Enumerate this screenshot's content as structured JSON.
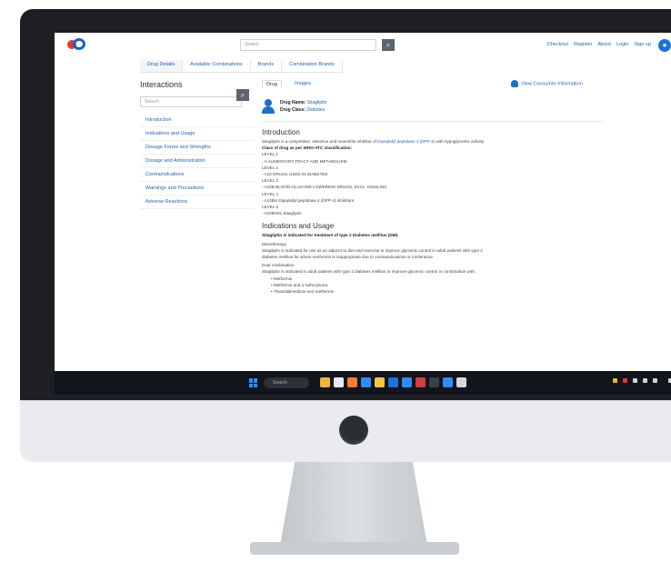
{
  "topbar": {
    "logo_caption": "",
    "search_placeholder": "Search",
    "links": [
      "Checkout",
      "Register",
      "About",
      "Login",
      "Sign up"
    ]
  },
  "tabs": [
    "Drug Details",
    "Available Combinations",
    "Brands",
    "Combination Brands"
  ],
  "sidebar": {
    "title": "Interactions",
    "search_placeholder": "Search",
    "items": [
      "Introduction",
      "Indications and Usage",
      "Dosage Forms and Strengths",
      "Dosage and Administration",
      "Contraindications",
      "Warnings and Precautions",
      "Adverse Reactions"
    ]
  },
  "content": {
    "subtabs": [
      "Drug",
      "Images"
    ],
    "consumer_link": "View Consumer Information",
    "drug_name_label": "Drug Name:",
    "drug_name": "Sitagliptin",
    "drug_class_label": "Drug Class:",
    "drug_class": "Diabetes",
    "intro_heading": "Introduction",
    "intro_lines": [
      {
        "text": "Sitagliptin is a competitive, selective and reversible inhibitor of ",
        "link": "Dipeptidyl peptidase 4 (DPP-4)",
        "tail": " with hypoglycemic activity."
      },
      {
        "bold": "Class of drug as per WHO-ATC classification:"
      },
      {
        "text": "LEVEL 1"
      },
      {
        "text": "- A ALIMENTARY TRACT AND METABOLISM"
      },
      {
        "text": "LEVEL 2"
      },
      {
        "text": "- A10 DRUGS USED IN DIABETES"
      },
      {
        "text": "LEVEL 3"
      },
      {
        "text": "- A10B BLOOD GLUCOSE LOWERING DRUGS, EXCL. INSULINS"
      },
      {
        "text": "LEVEL 4"
      },
      {
        "text": "- A10BH Dipeptidyl peptidase 4 (DPP-4) inhibitors"
      },
      {
        "text": "LEVEL 5"
      },
      {
        "text": "- A10BH01 Sitagliptin"
      }
    ],
    "indications_heading": "Indications and Usage",
    "indications_bold": "Sitagliptin is indicated for treatment of type 2 Diabetes mellitus (DM).",
    "indications_sub1": "Monotherapy",
    "indications_lines1": [
      "Sitagliptin is indicated for use as an adjunct to diet and exercise to improve glycemic control in adult patients with type 2",
      "diabetes mellitus for whom metformin is inappropriate due to contraindications or intolerance."
    ],
    "indications_sub2": "Dual combination",
    "indications_lines2": [
      "Sitagliptin is indicated in adult patients with type 2 diabetes mellitus to improve glycemic control in combination with:"
    ],
    "bullets": [
      "Metformin",
      "Metformin and a sulfonylurea",
      "Thiazolidinedione and metformin"
    ]
  },
  "taskbar": {
    "search_label": "Search",
    "tray_temp": "",
    "time": "",
    "date": ""
  },
  "colors": {
    "link": "#2a63b3",
    "accent_blue": "#1e73d8",
    "logo_red": "#e53935",
    "taskbar": "#12151b"
  }
}
